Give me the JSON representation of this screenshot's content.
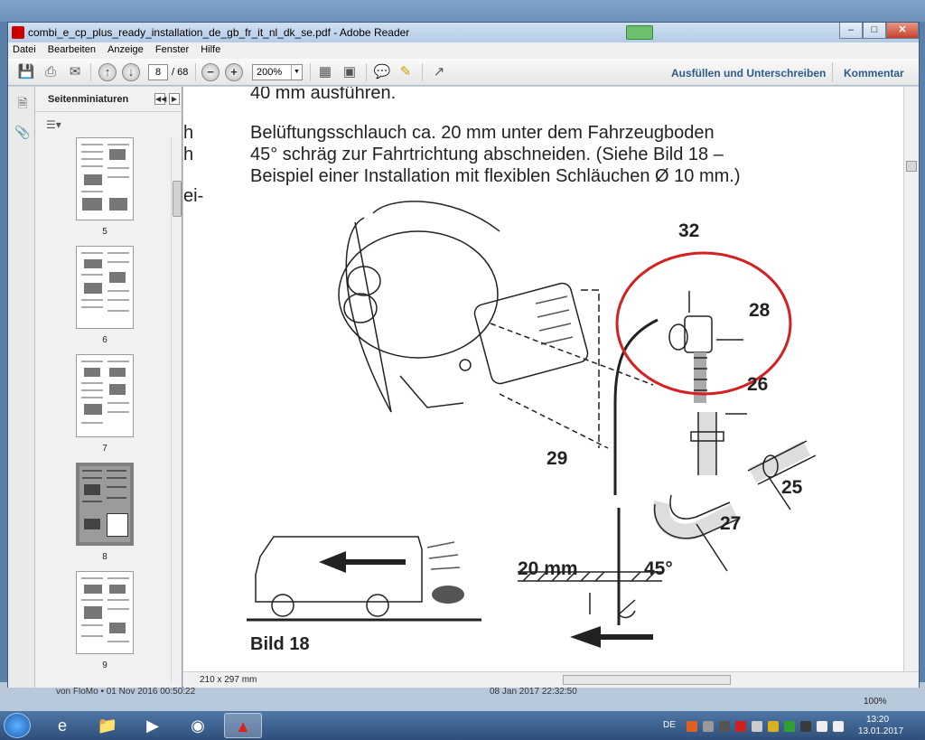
{
  "window": {
    "title": "combi_e_cp_plus_ready_installation_de_gb_fr_it_nl_dk_se.pdf - Adobe Reader",
    "min_label": "–",
    "max_label": "□",
    "close_label": "✕"
  },
  "menu": [
    "Datei",
    "Bearbeiten",
    "Anzeige",
    "Fenster",
    "Hilfe"
  ],
  "toolbar": {
    "page_current": "8",
    "page_total": "/ 68",
    "zoom": "200%",
    "fill_sign": "Ausfüllen und Unterschreiben",
    "comment": "Kommentar"
  },
  "sidebar": {
    "title": "Seitenminiaturen",
    "thumbnails": [
      {
        "label": "5"
      },
      {
        "label": "6"
      },
      {
        "label": "7"
      },
      {
        "label": "8",
        "selected": true
      },
      {
        "label": "9"
      }
    ]
  },
  "document": {
    "line_top": "40 mm ausführen.",
    "paragraph": [
      "Belüftungsschlauch ca. 20 mm unter dem Fahrzeugboden",
      "45° schräg zur Fahrtrichtung abschneiden. (Siehe Bild 18 –",
      "Beispiel einer Installation mit flexiblen Schläuchen Ø 10 mm.)"
    ],
    "left_fragments": [
      "h",
      "h",
      "ei-"
    ],
    "callouts": {
      "c32": "32",
      "c28": "28",
      "c26": "26",
      "c29": "29",
      "c25": "25",
      "c27": "27",
      "dim": "20 mm",
      "angle": "45°"
    },
    "figure_caption": "Bild 18"
  },
  "status": {
    "page_size": "210 x 297 mm",
    "zoom_indicator": "100%"
  },
  "taskbar": {
    "lang": "DE",
    "time": "13:20",
    "date": "13.01.2017"
  },
  "background": {
    "text1": "von FloMo • 01 Nov 2016 00:50:22",
    "text2": "08 Jan 2017 22:32:50"
  },
  "colors": {
    "highlight_circle": "#d42020",
    "link": "#2e5c8a"
  }
}
